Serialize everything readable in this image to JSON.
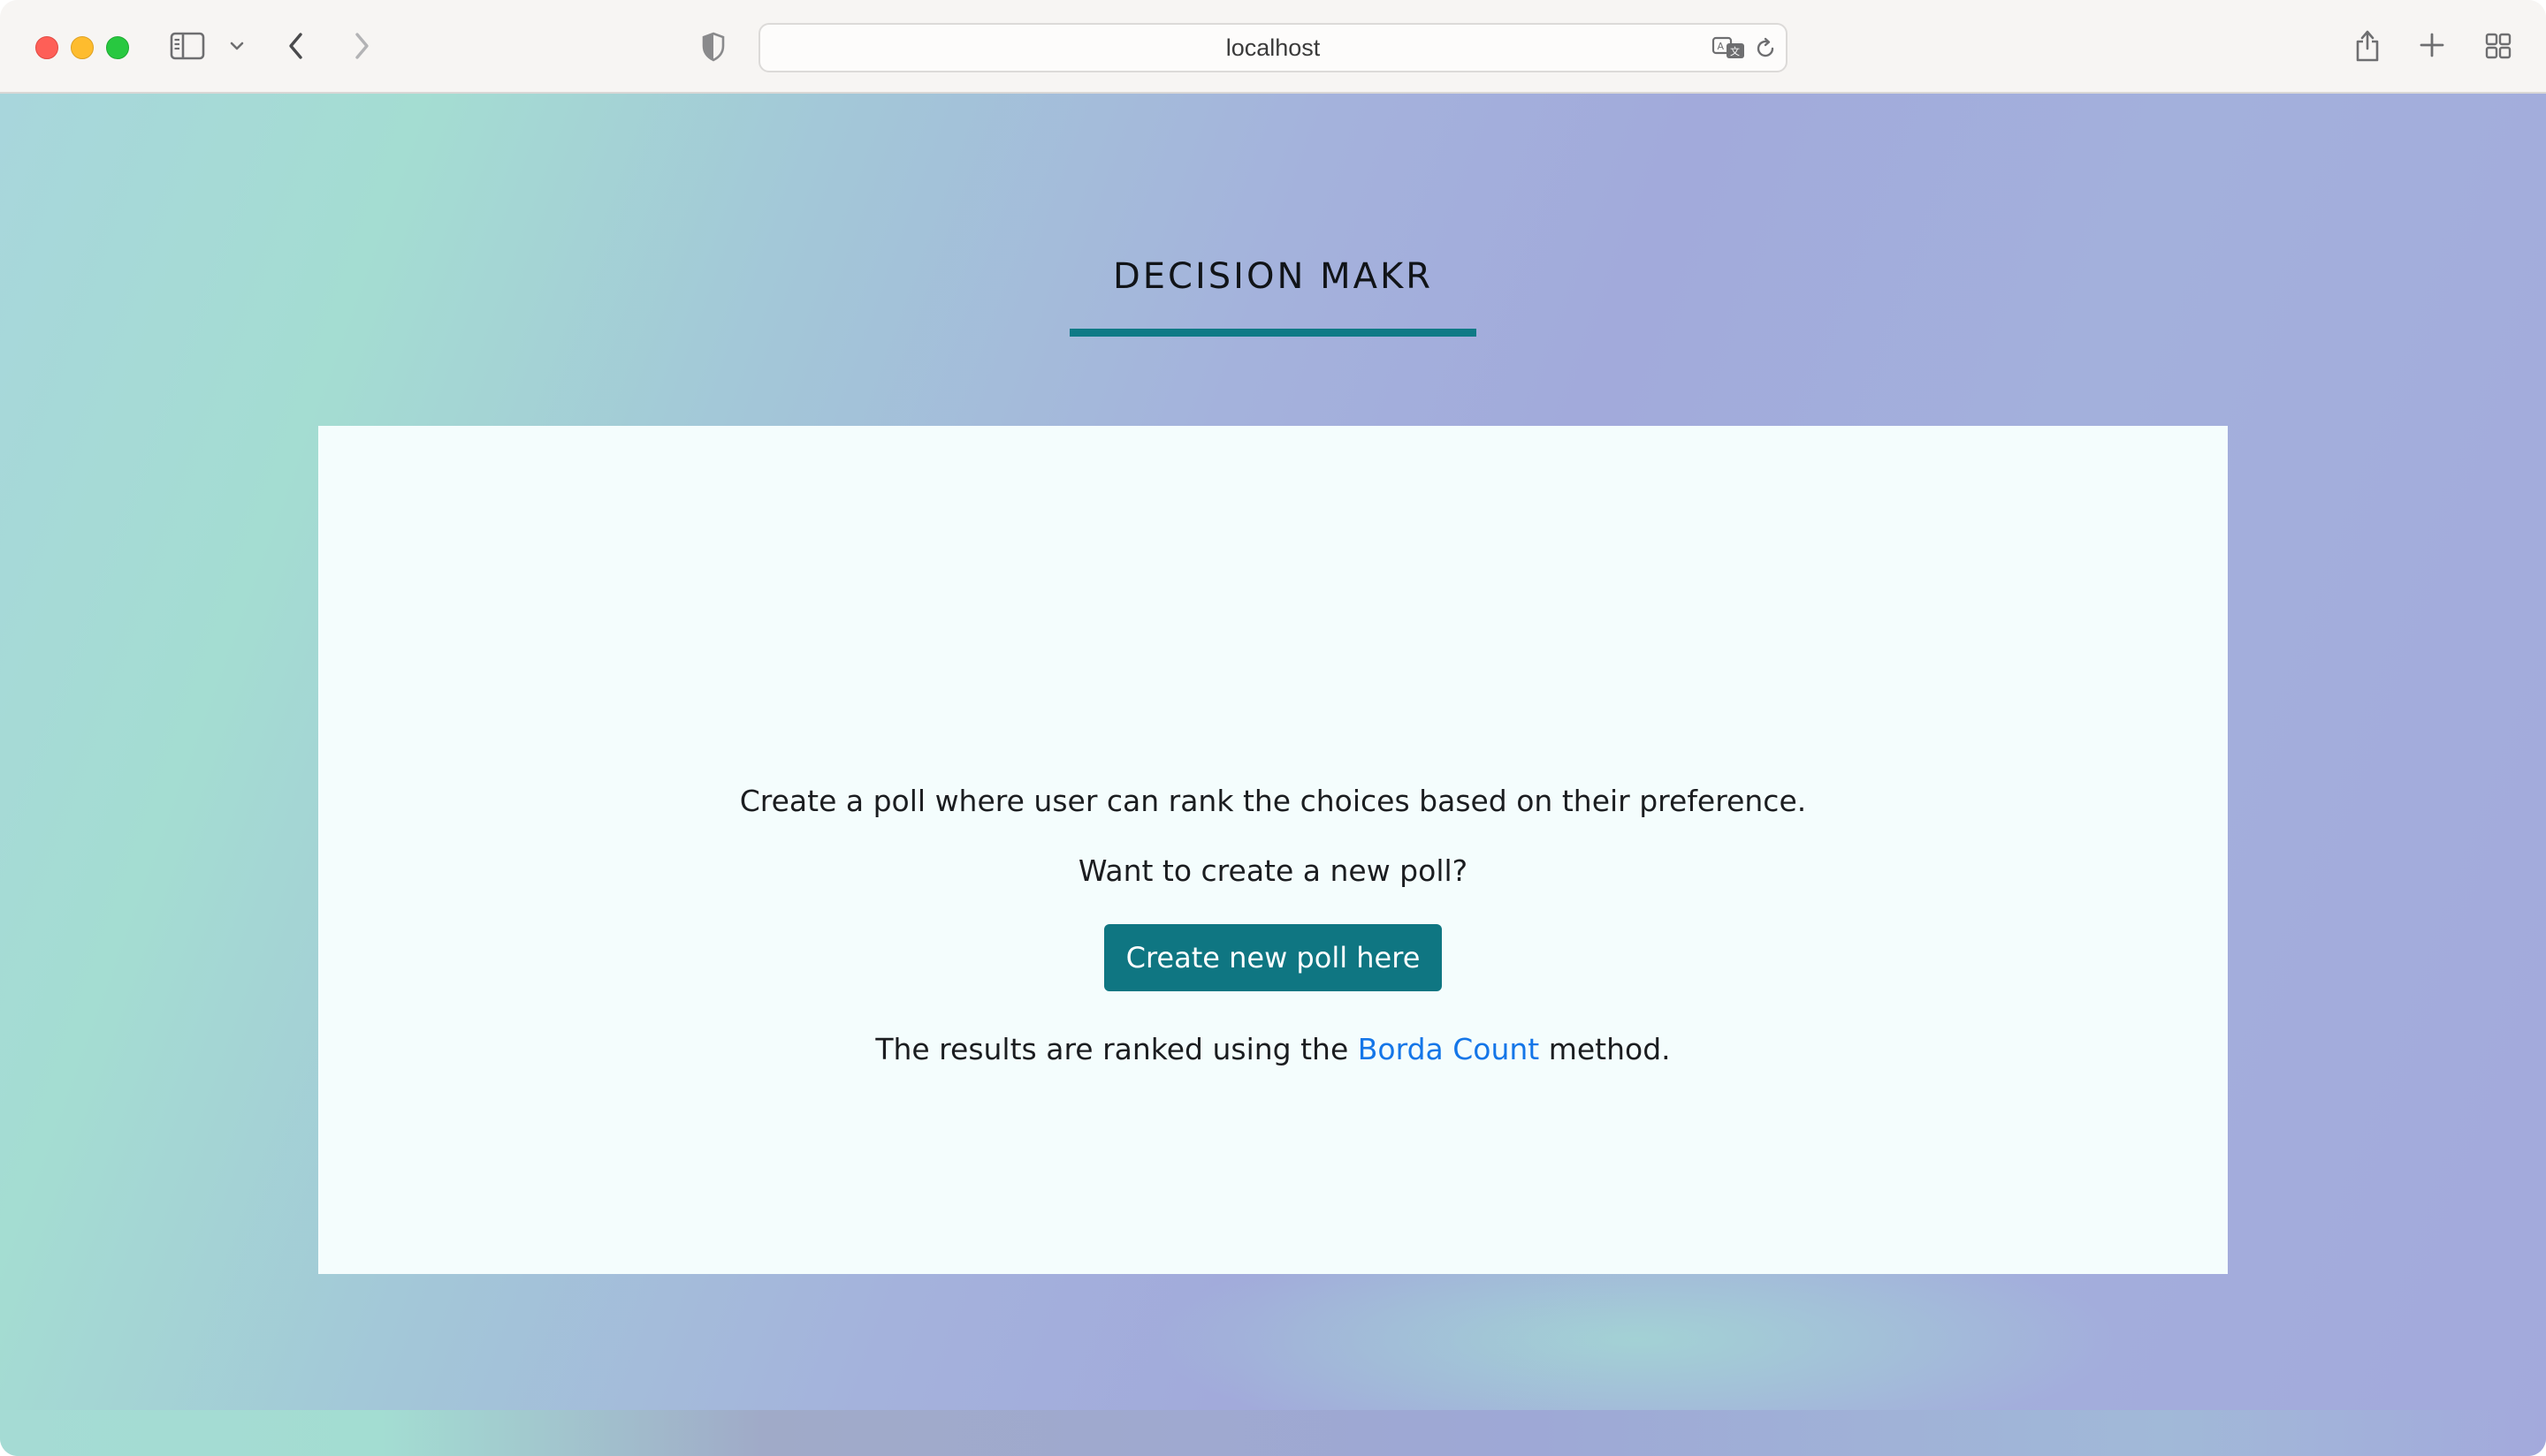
{
  "browser": {
    "url": "localhost",
    "icons": {
      "sidebar": "sidebar-icon",
      "chevron": "chevron-down-icon",
      "back": "back-arrow-icon",
      "forward": "forward-arrow-icon",
      "privacy": "shield-icon",
      "translate": "translate-icon",
      "reload": "reload-icon",
      "share": "share-icon",
      "new_tab": "plus-icon",
      "tab_overview": "grid-icon"
    }
  },
  "page": {
    "title": "DECISION MAKR",
    "description": "Create a poll where user can rank the choices based on their preference.",
    "prompt": "Want to create a new poll?",
    "cta_label": "Create new poll here",
    "results_prefix": "The results are ranked using the",
    "results_link": "Borda Count",
    "results_suffix": "method."
  },
  "colors": {
    "accent": "#0f7682",
    "link": "#1476e8",
    "card": "#f4fdfd",
    "text": "#1b1d20"
  }
}
